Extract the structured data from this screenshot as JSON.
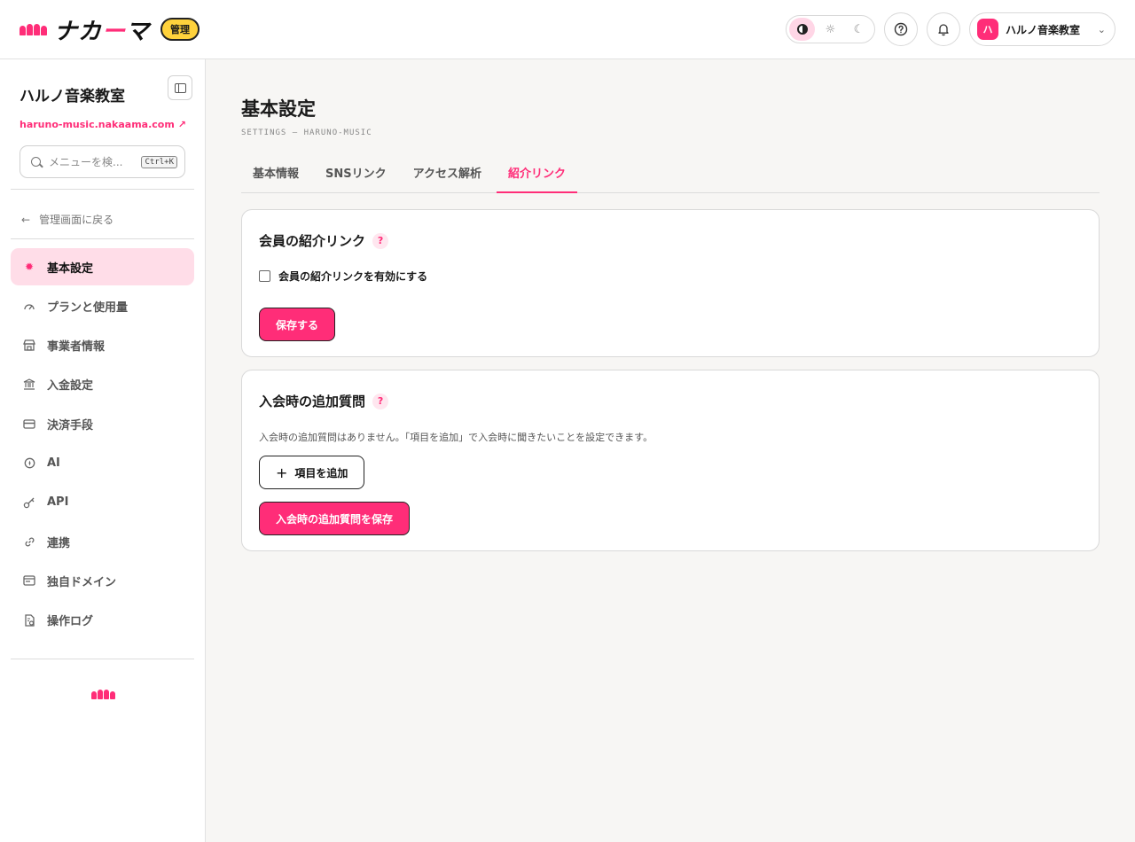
{
  "header": {
    "logo_text_a": "ナカ",
    "logo_text_dash": "ー",
    "logo_text_b": "マ",
    "admin_badge": "管理",
    "account_avatar": "ハ",
    "account_name": "ハルノ音楽教室"
  },
  "sidebar": {
    "org_name": "ハルノ音楽教室",
    "org_url": "haruno-music.nakaama.com",
    "search_placeholder": "メニューを検...",
    "search_shortcut": "Ctrl+K",
    "back_label": "管理画面に戻る",
    "items": [
      {
        "label": "基本設定",
        "icon": "sun-gear-icon",
        "active": true
      },
      {
        "label": "プランと使用量",
        "icon": "gauge-icon",
        "active": false
      },
      {
        "label": "事業者情報",
        "icon": "store-icon",
        "active": false
      },
      {
        "label": "入金設定",
        "icon": "bank-icon",
        "active": false
      },
      {
        "label": "決済手段",
        "icon": "credit-card-icon",
        "active": false
      },
      {
        "label": "AI",
        "icon": "ai-icon",
        "active": false
      },
      {
        "label": "API",
        "icon": "key-icon",
        "active": false
      },
      {
        "label": "連携",
        "icon": "link-icon",
        "active": false
      },
      {
        "label": "独自ドメイン",
        "icon": "domain-card-icon",
        "active": false
      },
      {
        "label": "操作ログ",
        "icon": "log-file-icon",
        "active": false
      }
    ]
  },
  "main": {
    "title": "基本設定",
    "subtitle": "SETTINGS — HARUNO-MUSIC",
    "tabs": [
      {
        "label": "基本情報",
        "active": false
      },
      {
        "label": "SNSリンク",
        "active": false
      },
      {
        "label": "アクセス解析",
        "active": false
      },
      {
        "label": "紹介リンク",
        "active": true
      }
    ],
    "referral_card": {
      "title": "会員の紹介リンク",
      "help": "?",
      "checkbox_label": "会員の紹介リンクを有効にする",
      "checkbox_checked": false,
      "save_label": "保存する"
    },
    "questions_card": {
      "title": "入会時の追加質問",
      "help": "?",
      "description": "入会時の追加質問はありません。「項目を追加」で入会時に聞きたいことを設定できます。",
      "add_label": "項目を追加",
      "save_label": "入会時の追加質問を保存"
    }
  },
  "colors": {
    "accent": "#ff2d78",
    "accent_soft": "#ffdde8",
    "badge": "#ffd23c"
  }
}
